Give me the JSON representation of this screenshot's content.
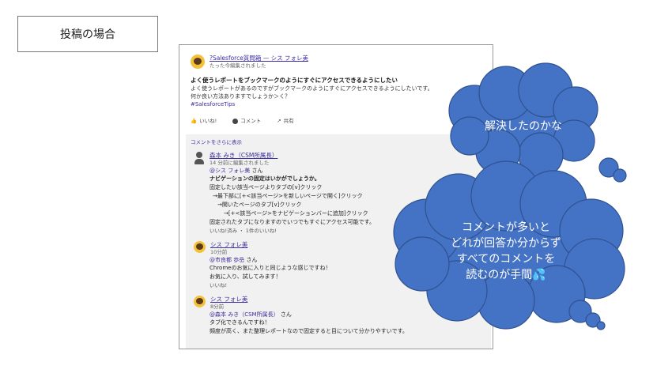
{
  "label": "投稿の場合",
  "post": {
    "author": "?Salesforce質問箱 — シス フォレ美",
    "time": "たった今編集されました",
    "title": "よく使うレポートをブックマークのようにすぐにアクセスできるようにしたい",
    "body1": "よく使うレポートがあるのですがブックマークのようにすぐにアクセスできるようにしたいです。",
    "body2": "何か良い方法ありますでしょうか＞く？",
    "tag": "#SalesforceTips",
    "actions": {
      "like": "いいね!",
      "comment": "コメント",
      "share": "共有"
    }
  },
  "comments": {
    "more": "コメントをさらに表示",
    "items": [
      {
        "author": "森本 みき（CSM所属長）",
        "time": "14 分前に編集されました",
        "mention": "@シス フォレ美",
        "san": " さん",
        "lines": [
          "ナビゲーションの固定はいかがでしょうか。",
          "固定したい該当ページよりタブの[v]クリック",
          "→最下部に[+<該当ページ>を新しいページで開く]クリック",
          "→開いたページのタブ[v]クリック",
          "→[+<該当ページ>をナビゲーションバーに追加]クリック",
          "固定されたタブになりますのでいつでもすぐにアクセス可能です。"
        ],
        "like": "いいね!済み ・ 1件のいいね!"
      },
      {
        "author": "シス フォレ美",
        "time": "10分前",
        "mention": "@市良都 歩岳",
        "san": " さん",
        "lines": [
          "Chromeのお気に入りと同じような感じですね！",
          "お気に入り、試してみます！"
        ],
        "like": "いいね!"
      },
      {
        "author": "シス フォレ美",
        "time": "8分前",
        "mention": "@森本 みき（CSM所属長）",
        "san": " さん",
        "lines": [
          "タブ化できるんですね！",
          "頻度が高く、また整理レポートなので固定すると目について分かりやすいです。"
        ],
        "like": ""
      }
    ]
  },
  "clouds": {
    "small": "解決したのかな",
    "large": [
      "コメントが多いと",
      "どれが回答か分からず",
      "すべてのコメントを",
      "読むのが手間💦"
    ]
  },
  "colors": {
    "cloud": "#4472c4",
    "cloud_stroke": "#2f528f",
    "link": "#3a2d9c"
  }
}
